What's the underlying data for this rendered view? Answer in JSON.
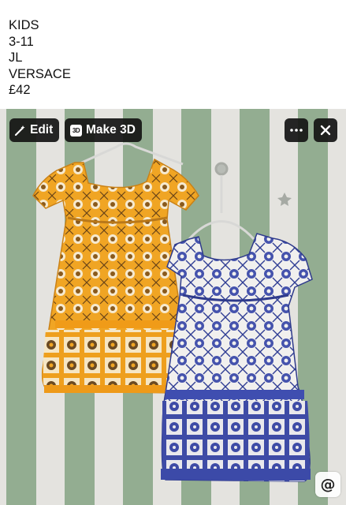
{
  "post": {
    "caption_lines": [
      "KIDS",
      "3-11",
      "JL",
      "VERSACE",
      "£42"
    ]
  },
  "overlay": {
    "edit_label": "Edit",
    "edit_icon": "magic-wand-icon",
    "make3d_label": "Make 3D",
    "make3d_icon_text": "3D",
    "more_icon": "more-icon",
    "close_icon": "close-icon",
    "mention_icon": "at-sign-icon",
    "mention_text": "@"
  },
  "photo": {
    "subject": "two-printed-dresses",
    "colors": {
      "wall_green": "#93ad91",
      "wall_white": "#e4e3df",
      "dress_yellow": "#f0a524",
      "dress_blue": "#4553ad",
      "dress_cream": "#f2ecdc"
    }
  }
}
